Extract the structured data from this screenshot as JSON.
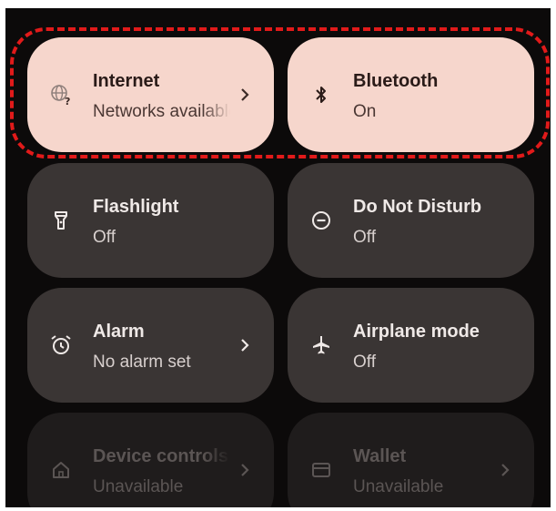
{
  "colors": {
    "panel_bg": "#0c0a0a",
    "tile_bg": "#3a3534",
    "tile_active_bg": "#f6d6cc",
    "highlight_border": "#e11a1a"
  },
  "tiles": [
    {
      "title": "Internet",
      "subtitle": "Networks available",
      "icon": "wifi-question-icon",
      "chevron": true,
      "state": "active"
    },
    {
      "title": "Bluetooth",
      "subtitle": "On",
      "icon": "bluetooth-icon",
      "chevron": false,
      "state": "active"
    },
    {
      "title": "Flashlight",
      "subtitle": "Off",
      "icon": "flashlight-icon",
      "chevron": false,
      "state": "off"
    },
    {
      "title": "Do Not Disturb",
      "subtitle": "Off",
      "icon": "do-not-disturb-icon",
      "chevron": false,
      "state": "off"
    },
    {
      "title": "Alarm",
      "subtitle": "No alarm set",
      "icon": "alarm-icon",
      "chevron": true,
      "state": "off"
    },
    {
      "title": "Airplane mode",
      "subtitle": "Off",
      "icon": "airplane-icon",
      "chevron": false,
      "state": "off"
    },
    {
      "title": "Device controls",
      "subtitle": "Unavailable",
      "icon": "home-icon",
      "chevron": true,
      "state": "unavailable"
    },
    {
      "title": "Wallet",
      "subtitle": "Unavailable",
      "icon": "wallet-icon",
      "chevron": true,
      "state": "unavailable"
    }
  ]
}
